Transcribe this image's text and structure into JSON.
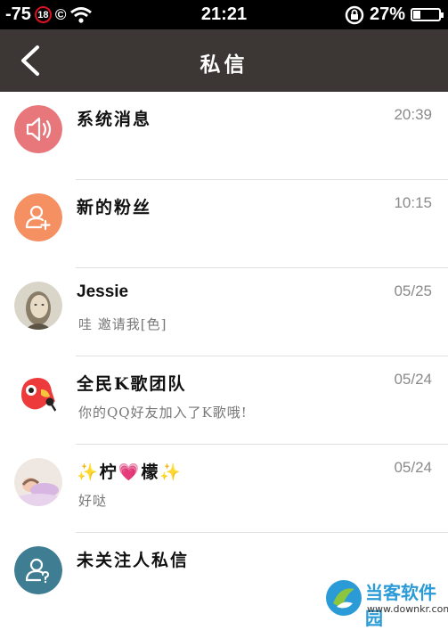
{
  "status": {
    "signal": "-75",
    "badge": "18",
    "copyright": "©",
    "time": "21:21",
    "battery": "27%",
    "battery_level": 0.27
  },
  "nav": {
    "title": "私信"
  },
  "colors": {
    "system": "#e8777c",
    "fans": "#f49062",
    "unfollowed": "#3f7d93",
    "nav_bg": "#3c3634"
  },
  "items": [
    {
      "name": "系统消息",
      "message": "",
      "time": "20:39"
    },
    {
      "name": "新的粉丝",
      "message": "",
      "time": "10:15"
    },
    {
      "name": "Jessie",
      "message": "哇 邀请我[色]",
      "time": "05/25"
    },
    {
      "name": "全民K歌团队",
      "message": "你的QQ好友加入了K歌哦!",
      "time": "05/24"
    },
    {
      "name": "✨柠💗檬✨",
      "message": "好哒",
      "time": "05/24"
    },
    {
      "name": "未关注人私信",
      "message": "",
      "time": ""
    }
  ],
  "watermark": {
    "name": "当客软件园",
    "url": "www.downkr.com"
  }
}
